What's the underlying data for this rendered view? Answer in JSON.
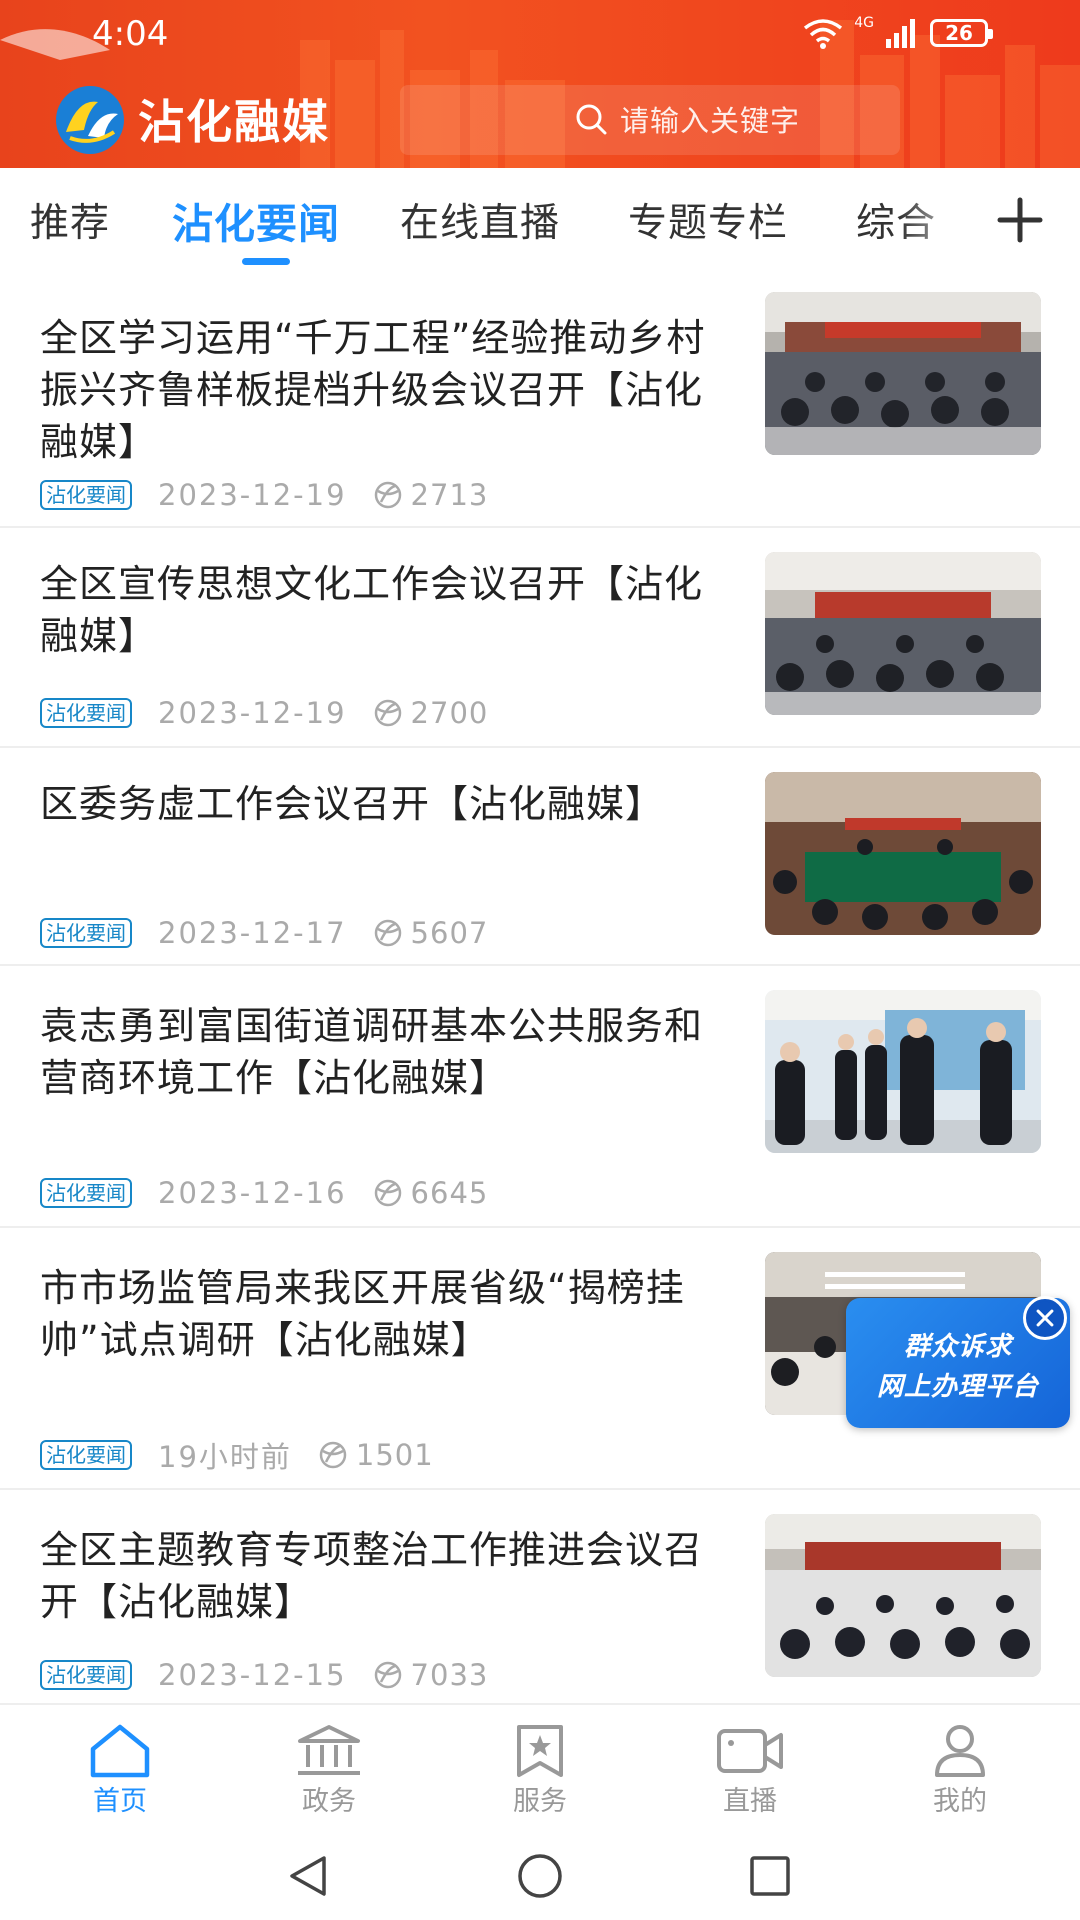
{
  "status_bar": {
    "time": "4:04",
    "network": "4G",
    "battery": "26"
  },
  "header": {
    "app_title": "沾化融媒",
    "search_placeholder": "请输入关键字"
  },
  "tabs": [
    {
      "label": "推荐",
      "active": false
    },
    {
      "label": "沾化要闻",
      "active": true
    },
    {
      "label": "在线直播",
      "active": false
    },
    {
      "label": "专题专栏",
      "active": false
    },
    {
      "label": "综合",
      "active": false
    }
  ],
  "news": [
    {
      "title": "全区学习运用“千万工程”经验推动乡村振兴齐鲁样板提档升级会议召开【沾化融媒】",
      "tag": "沾化要闻",
      "date": "2023-12-19",
      "views": "2713"
    },
    {
      "title": "全区宣传思想文化工作会议召开【沾化融媒】",
      "tag": "沾化要闻",
      "date": "2023-12-19",
      "views": "2700"
    },
    {
      "title": "区委务虚工作会议召开【沾化融媒】",
      "tag": "沾化要闻",
      "date": "2023-12-17",
      "views": "5607"
    },
    {
      "title": "袁志勇到富国街道调研基本公共服务和营商环境工作【沾化融媒】",
      "tag": "沾化要闻",
      "date": "2023-12-16",
      "views": "6645"
    },
    {
      "title": "市市场监管局来我区开展省级“揭榜挂帅”试点调研【沾化融媒】",
      "tag": "沾化要闻",
      "date": "19小时前",
      "views": "1501"
    },
    {
      "title": "全区主题教育专项整治工作推进会议召开【沾化融媒】",
      "tag": "沾化要闻",
      "date": "2023-12-15",
      "views": "7033"
    }
  ],
  "float_banner": {
    "line1": "群众诉求",
    "line2": "网上办理平台"
  },
  "bottom_nav": [
    {
      "label": "首页",
      "icon": "home-icon",
      "active": true
    },
    {
      "label": "政务",
      "icon": "government-icon",
      "active": false
    },
    {
      "label": "服务",
      "icon": "service-star-icon",
      "active": false
    },
    {
      "label": "直播",
      "icon": "video-camera-icon",
      "active": false
    },
    {
      "label": "我的",
      "icon": "user-icon",
      "active": false
    }
  ],
  "colors": {
    "header_red": "#ee4520",
    "accent_blue": "#1e90ff",
    "tag_blue": "#1787c8",
    "banner_blue": "#1f7ae6"
  }
}
